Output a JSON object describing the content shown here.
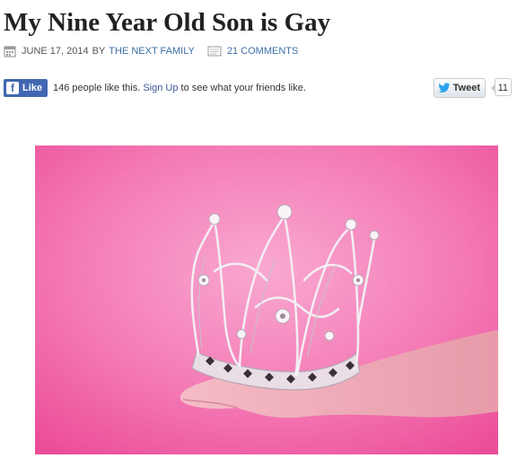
{
  "post": {
    "title": "My Nine Year Old Son is Gay",
    "date": "JUNE 17, 2014",
    "by_label": "BY",
    "author": "THE NEXT FAMILY",
    "comments": "21 COMMENTS"
  },
  "social": {
    "like_label": "Like",
    "like_text": "146 people like this.",
    "signup_label": "Sign Up",
    "like_suffix": "to see what your friends like.",
    "tweet_label": "Tweet",
    "tweet_count": "11"
  },
  "image": {
    "subject": "hand holding a silver tiara crown against a pink background"
  },
  "colors": {
    "facebook": "#4267b2",
    "link": "#3b6ea5",
    "photo_background": "#f26aa8"
  }
}
